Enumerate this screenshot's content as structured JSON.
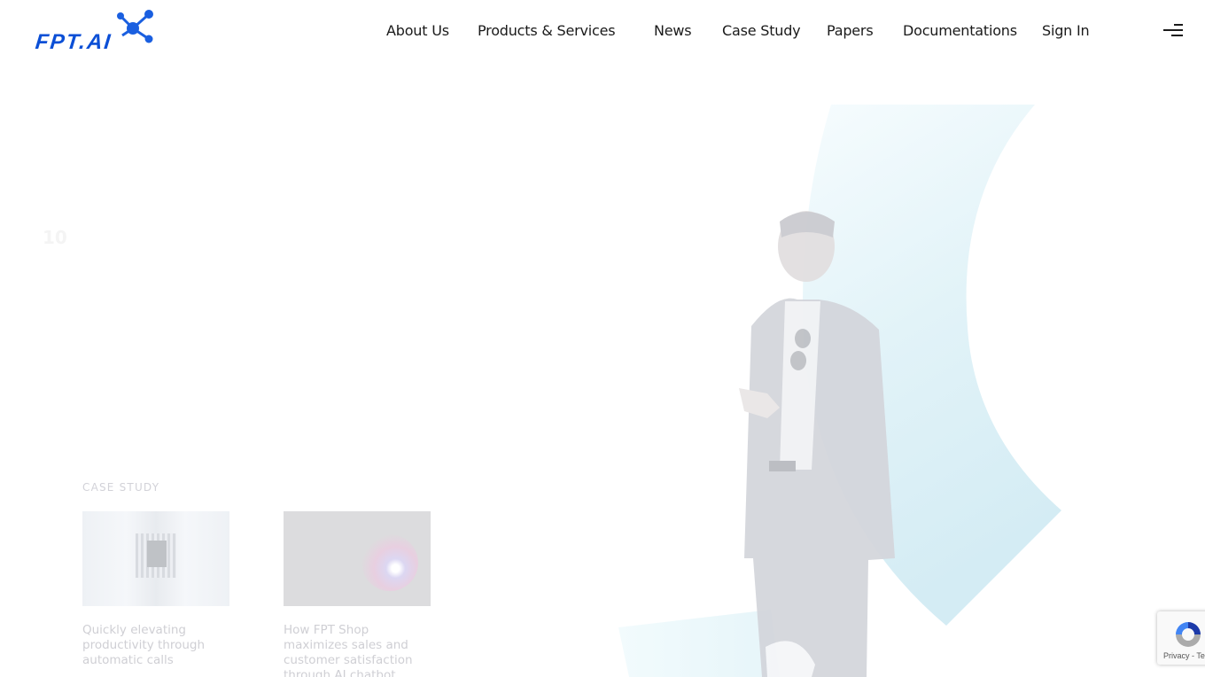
{
  "brand": {
    "name": "FPT.AI",
    "logo_text": "FPT.AI",
    "color": "#0b4fd6"
  },
  "nav": {
    "items": [
      {
        "label": "About Us"
      },
      {
        "label": "Products & Services"
      },
      {
        "label": "News"
      },
      {
        "label": "Case Study"
      },
      {
        "label": "Papers"
      },
      {
        "label": "Documentations"
      },
      {
        "label": "Sign In"
      }
    ],
    "menu_icon": "hamburger-menu-icon"
  },
  "hero": {
    "faint_glyph": "10",
    "accent_color": "#d6eef6"
  },
  "case_study": {
    "label": "CASE STUDY",
    "cards": [
      {
        "title": "Quickly elevating productivity through automatic calls",
        "thumbnail": "server-corridor-image"
      },
      {
        "title": "How FPT Shop maximizes sales and customer satisfaction through AI chatbot",
        "thumbnail": "plasma-ball-image"
      }
    ]
  },
  "recaptcha": {
    "text": "Privacy - Terms"
  }
}
